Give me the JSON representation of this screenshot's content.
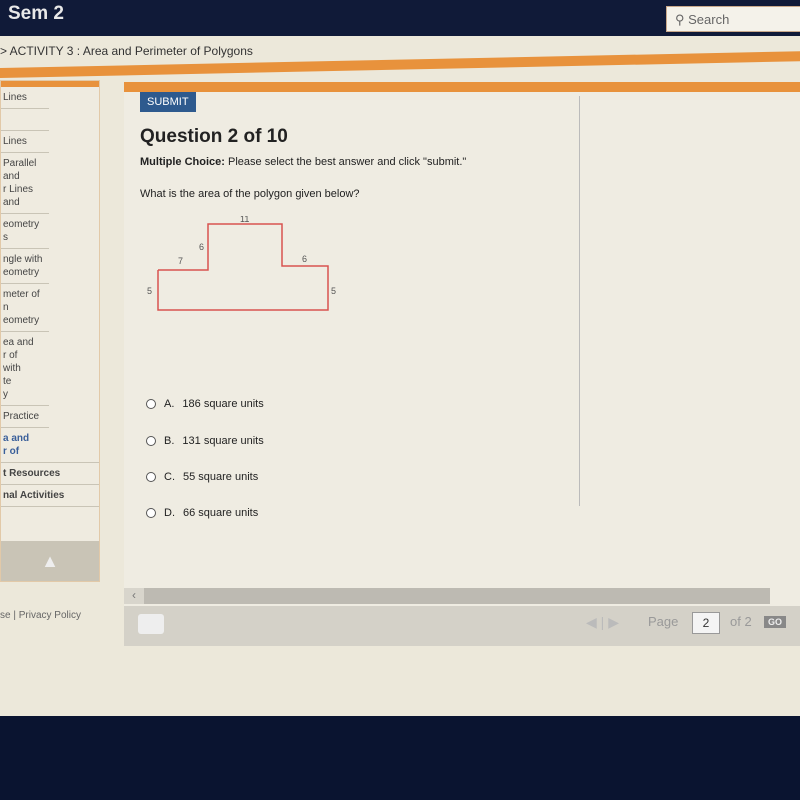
{
  "header": {
    "title": "Sem 2",
    "search_placeholder": "Search"
  },
  "breadcrumb": "> ACTIVITY 3 : Area and Perimeter of Polygons",
  "sidebar": {
    "items": [
      {
        "label": "Lines"
      },
      {
        "label": ""
      },
      {
        "label": "Lines"
      },
      {
        "label": "Parallel and\nr Lines and"
      },
      {
        "label": "eometry\ns"
      },
      {
        "label": "ngle with\neometry"
      },
      {
        "label": "meter of\nn\neometry"
      },
      {
        "label": "ea and\nr of\nwith\nte\ny"
      },
      {
        "label": " Practice"
      },
      {
        "label": "a and\nr of",
        "style": "blue"
      },
      {
        "label": "t Resources",
        "style": "bold"
      },
      {
        "label": "nal Activities",
        "style": "bold"
      }
    ]
  },
  "footer": {
    "left": "se",
    "sep": "|",
    "privacy": "Privacy Policy"
  },
  "main": {
    "submit_label": "SUBMIT",
    "question_title": "Question 2 of 10",
    "instruction_bold": "Multiple Choice:",
    "instruction": " Please select the best answer and click \"submit.\"",
    "prompt": "What is the area of the polygon given below?",
    "figure_labels": {
      "top": "11",
      "inner_left": "6",
      "left_step": "7",
      "right_step": "6",
      "left": "5",
      "right": "5"
    },
    "choices": [
      {
        "letter": "A.",
        "text": "186 square units"
      },
      {
        "letter": "B.",
        "text": "131 square units"
      },
      {
        "letter": "C.",
        "text": "55 square units"
      },
      {
        "letter": "D.",
        "text": "66 square units"
      }
    ]
  },
  "pager": {
    "page_label": "Page",
    "current": "2",
    "of_label": "of 2",
    "go_label": "GO"
  },
  "colors": {
    "accent": "#e8923c",
    "submit": "#2e5a8e",
    "polygon": "#d9534f"
  }
}
